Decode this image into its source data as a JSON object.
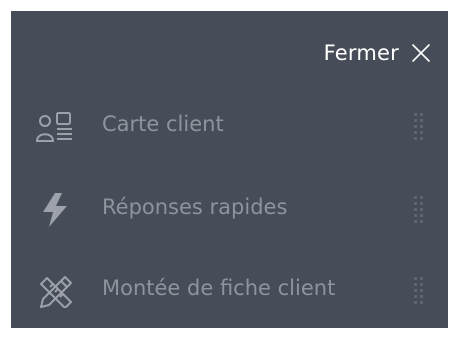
{
  "header": {
    "close_label": "Fermer",
    "close_icon": "close-x-icon"
  },
  "menu": {
    "items": [
      {
        "label": "Carte client",
        "icon": "customer-card-icon",
        "handle_icon": "drag-handle-icon"
      },
      {
        "label": "Réponses rapides",
        "icon": "lightning-bolt-icon",
        "handle_icon": "drag-handle-icon"
      },
      {
        "label": "Montée de fiche client",
        "icon": "pencil-ruler-icon",
        "handle_icon": "drag-handle-icon"
      }
    ]
  },
  "colors": {
    "panel_background": "#474d58",
    "header_text": "#ffffff",
    "item_text": "#8e939c",
    "icon_color": "#9ca1aa",
    "handle_color": "#5f6570"
  }
}
